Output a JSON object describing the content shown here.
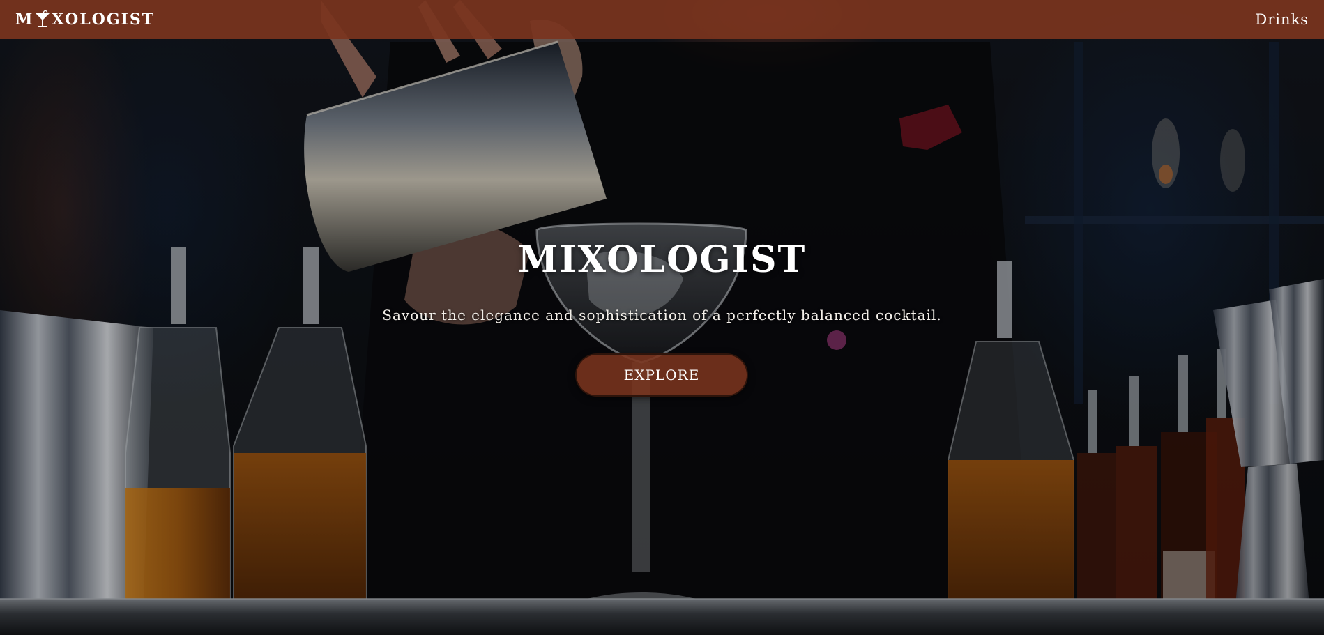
{
  "navbar": {
    "brand_prefix": "M",
    "brand_suffix": "XOLOGIST",
    "links": [
      {
        "label": "Drinks"
      }
    ],
    "background_color": "#7a341e"
  },
  "hero": {
    "title": "MIXOLOGIST",
    "tagline": "Savour the elegance and sophistication of a perfectly balanced cocktail.",
    "cta_label": "EXPLORE",
    "cta_color": "#7a341e"
  },
  "icons": {
    "brand_logo": "martini-glass-icon"
  }
}
